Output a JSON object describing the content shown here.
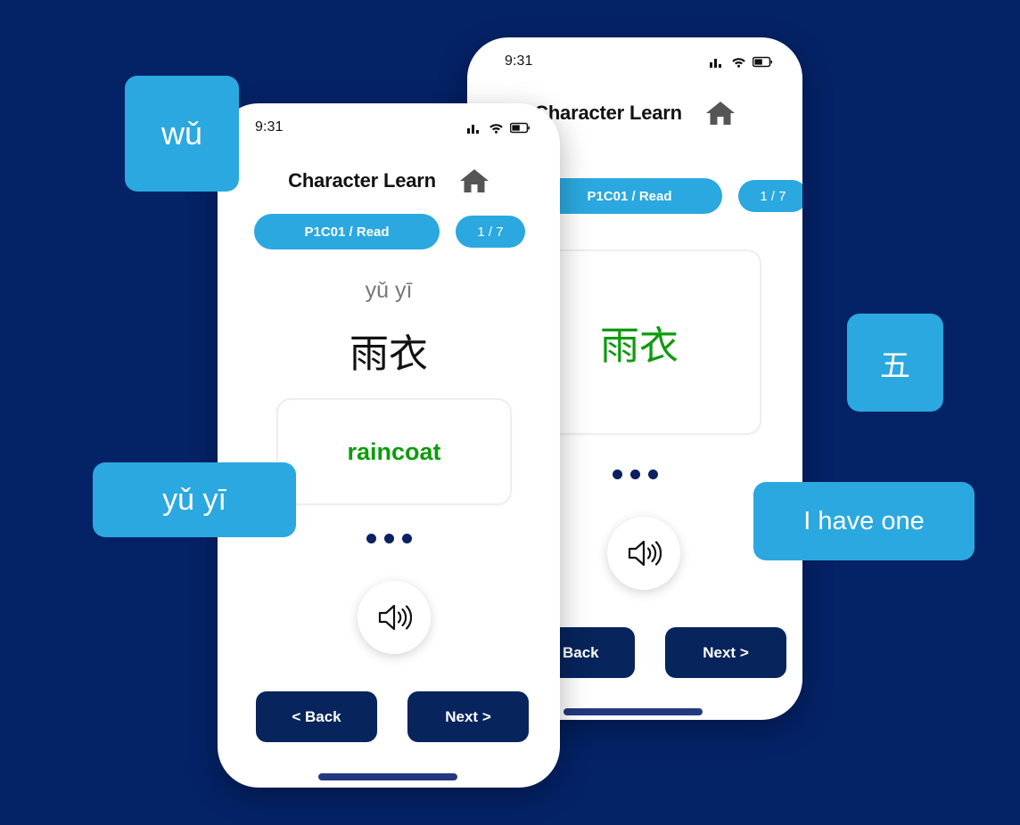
{
  "background_color": "#042266",
  "accent_blue": "#2BA8DF",
  "navy": "#07245C",
  "green": "#0D9B0D",
  "phones": {
    "back": {
      "status": {
        "time": "9:31",
        "signal_icon": "signal-bars-icon",
        "wifi_icon": "wifi-icon",
        "battery_icon": "battery-icon"
      },
      "header": {
        "title": "Character Learn",
        "home_icon": "home-icon"
      },
      "pills": {
        "lesson": "P1C01 / Read",
        "count": "1 / 7"
      },
      "card": {
        "answer": "雨衣"
      },
      "dots_count": 3,
      "speaker_icon": "speaker-icon",
      "nav": {
        "back": "< Back",
        "next": "Next >"
      }
    },
    "front": {
      "status": {
        "time": "9:31",
        "signal_icon": "signal-bars-icon",
        "wifi_icon": "wifi-icon",
        "battery_icon": "battery-icon"
      },
      "header": {
        "title": "Character Learn",
        "home_icon": "home-icon"
      },
      "pills": {
        "lesson": "P1C01 / Read",
        "count": "1 / 7"
      },
      "word": {
        "pinyin": "yǔ yī",
        "hanzi": "雨衣"
      },
      "card": {
        "answer": "raincoat"
      },
      "dots_count": 3,
      "speaker_icon": "speaker-icon",
      "nav": {
        "back": "< Back",
        "next": "Next >"
      }
    }
  },
  "callouts": {
    "wu_pinyin": "wǔ",
    "yuyi_pinyin": "yǔ yī",
    "wu_hanzi": "五",
    "i_have_one": "I have one"
  }
}
